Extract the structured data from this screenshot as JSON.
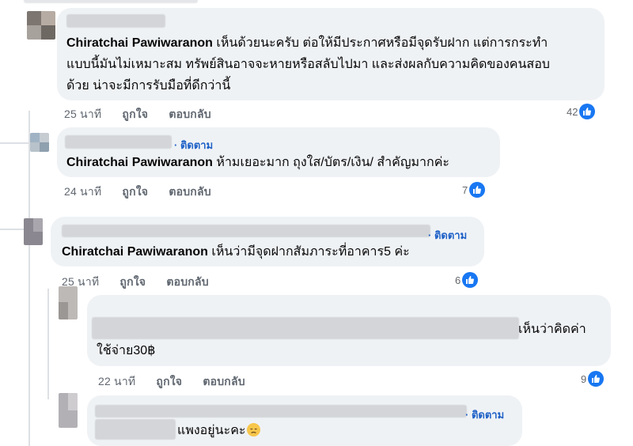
{
  "comments": [
    {
      "mention": "Chiratchai Pawiwaranon",
      "lines": [
        "เห็นด้วยนะครับ ต่อให้มีประกาศหรือมีจุดรับฝาก แต่การกระทำ",
        "แบบนี้มันไม่เหมาะสม ทรัพย์สินอาจจะหายหรือสลับไปมา และส่งผลกับความคิดของคนสอบ",
        "ด้วย น่าจะมีการรับมือที่ดีกว่านี้"
      ],
      "time": "25 นาที",
      "like": "ถูกใจ",
      "reply": "ตอบกลับ",
      "reactions": "42"
    },
    {
      "follow": "· ติดตาม",
      "mention": "Chiratchai Pawiwaranon",
      "text": "ห้ามเยอะมาก ถุงใส/บัตร/เงิน/ สำคัญมากค่ะ",
      "time": "24 นาที",
      "like": "ถูกใจ",
      "reply": "ตอบกลับ",
      "reactions": "7"
    },
    {
      "follow": "· ติดตาม",
      "mention": "Chiratchai Pawiwaranon",
      "text": "เห็นว่ามีจุดฝากสัมภาระที่อาคาร5 ค่ะ",
      "time": "25 นาที",
      "like": "ถูกใจ",
      "reply": "ตอบกลับ",
      "reactions": "6"
    },
    {
      "text_end": "เห็นว่าคิดค่า",
      "text_line2": "ใช้จ่าย30฿",
      "time": "22 นาที",
      "like": "ถูกใจ",
      "reply": "ตอบกลับ",
      "reactions": "9"
    },
    {
      "follow": "· ติดตาม",
      "text": "แพงอยู่นะคะ",
      "emoji": "disappointed-face"
    }
  ],
  "colors": {
    "bubble": "#eff2f5",
    "follow_link": "#1f61c7",
    "like_blue": "#1877f2",
    "meta_text": "#606770"
  }
}
